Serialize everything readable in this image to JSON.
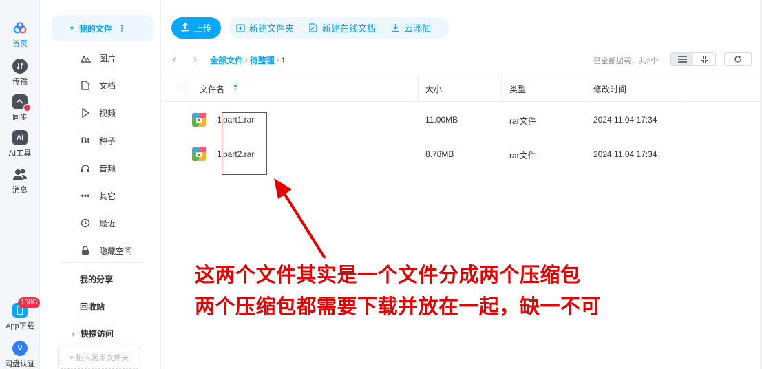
{
  "rail": {
    "home": "首页",
    "transfer": "传输",
    "sync": "同步",
    "ai": "AI工具",
    "messages": "消息",
    "app_badge": "100G",
    "app_download": "App下载",
    "verify": "网盘认证"
  },
  "nav": {
    "my_files": "我的文件",
    "items": [
      "图片",
      "文档",
      "视频",
      "种子",
      "音频",
      "其它",
      "最近",
      "隐藏空间"
    ],
    "bt_glyph": "Bt",
    "my_share": "我的分享",
    "recycle": "回收站",
    "quick_access": "快捷访问",
    "drop_hint": "+ 拖入常用文件夹"
  },
  "toolbar": {
    "upload": "上传",
    "new_folder": "新建文件夹",
    "new_online_doc": "新建在线文档",
    "cloud_add": "云添加"
  },
  "breadcrumb": {
    "root": "全部文件",
    "folder": "待整理",
    "current": "1"
  },
  "status": {
    "loaded": "已全部加载，共2个"
  },
  "table": {
    "headers": {
      "name": "文件名",
      "size": "大小",
      "type": "类型",
      "modified": "修改时间"
    },
    "rows": [
      {
        "name_prefix": "1",
        "name": "part1.rar",
        "size": "11.00MB",
        "type": "rar文件",
        "modified": "2024.11.04 17:34"
      },
      {
        "name_prefix": "1",
        "name": "part2.rar",
        "size": "8.78MB",
        "type": "rar文件",
        "modified": "2024.11.04 17:34"
      }
    ]
  },
  "annotation": {
    "line1": "这两个文件其实是一个文件分成两个压缩包",
    "line2": "两个压缩包都需要下载并放在一起，缺一不可"
  },
  "colors": {
    "accent": "#06a7ff",
    "annotation_red": "#e60000"
  }
}
